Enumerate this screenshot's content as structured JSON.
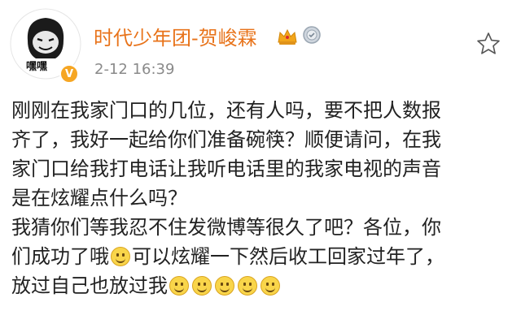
{
  "header": {
    "username": "时代少年团-贺峻霖",
    "timestamp": "2-12 16:39",
    "avatar_caption": "嘿嘿",
    "verified_badge": "V"
  },
  "badges": [
    "crown-icon",
    "medal-icon"
  ],
  "colors": {
    "username": "#e8731a",
    "timestamp": "#8a8a8a",
    "badge": "#f6a623"
  },
  "content": {
    "lines": [
      "刚刚在我家门口的几位，还有人吗，要不把人数报",
      "齐了，我好一起给你们准备碗筷？顺便请问，在我",
      "家门口给我打电话让我听电话里的我家电视的声音",
      "是在炫耀点什么吗？",
      "我猜你们等我忍不住发微博等很久了吧？各位，你",
      "们成功了哦",
      "可以炫耀一下然后收工回家过年了，",
      "放过自己也放过我"
    ]
  }
}
